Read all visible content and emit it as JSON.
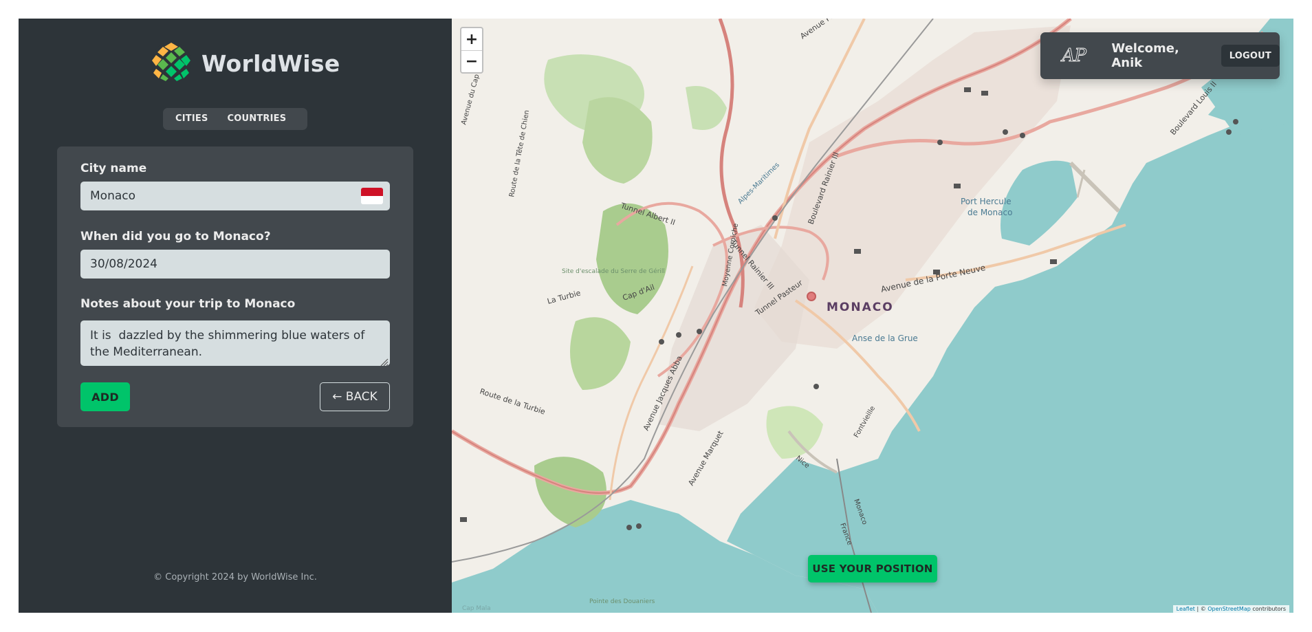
{
  "app": {
    "brand": "WorldWise",
    "tabs": [
      "CITIES",
      "COUNTRIES"
    ],
    "copyright": "© Copyright 2024 by WorldWise Inc."
  },
  "form": {
    "city_label": "City name",
    "city_value": "Monaco",
    "flag_icon": "monaco-flag",
    "date_label": "When did you go to Monaco?",
    "date_value": "30/08/2024",
    "notes_label": "Notes about your trip to Monaco",
    "notes_value": "It is  dazzled by the shimmering blue waters of the Mediterranean.",
    "add_label": "ADD",
    "back_label": "← BACK"
  },
  "map": {
    "zoom_in": "+",
    "zoom_out": "−",
    "city_label": "MONACO",
    "use_position_label": "USE YOUR POSITION",
    "attribution": {
      "leaflet": "Leaflet",
      "separator": " | © ",
      "osm": "OpenStreetMap",
      "suffix": " contributors"
    },
    "place_labels": [
      "Port Hercule",
      "de Monaco",
      "Anse de la Grue",
      "Avenue de la Porte Neuve",
      "Tunnel Albert II",
      "Tunnel Rainier III",
      "Tunnel Pasteur",
      "Route de la Turbie",
      "Avenue Jacques Abba",
      "Boulevard Rainier III",
      "Alpes-Maritimes",
      "Cap d'Ail",
      "La Turbie",
      "Avenue Marquet",
      "Boulevard Louis II",
      "Avenue Princesse",
      "Route de la Tête de Chien",
      "Avenue du Cap",
      "Site d'escalade du Serre de Gérill",
      "Pointe des Douaniers",
      "Cap Mala",
      "Monaco",
      "France",
      "Nice",
      "Fontvieille",
      "Moyenne Corniche"
    ]
  },
  "user": {
    "avatar_initials": "AP",
    "welcome": "Welcome, Anik",
    "logout_label": "LOGOUT"
  },
  "colors": {
    "sidebar_bg": "#2d3439",
    "panel_bg": "#42484d",
    "accent_green": "#00c46a",
    "input_bg": "#d6dee0",
    "sea": "#8fcbcb"
  }
}
